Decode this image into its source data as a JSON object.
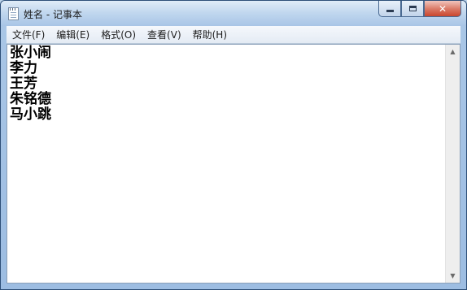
{
  "window": {
    "title": "姓名 - 记事本"
  },
  "menu": [
    {
      "label": "文件(F)"
    },
    {
      "label": "编辑(E)"
    },
    {
      "label": "格式(O)"
    },
    {
      "label": "查看(V)"
    },
    {
      "label": "帮助(H)"
    }
  ],
  "document": {
    "lines": [
      "张小闹",
      "李力",
      "王芳",
      "朱铭德",
      "马小跳"
    ]
  },
  "icons": {
    "app": "notepad-icon",
    "minimize": "minimize-icon",
    "maximize": "maximize-icon",
    "close": "close-icon",
    "scroll_up": "scroll-up-arrow-icon",
    "scroll_down": "scroll-down-arrow-icon"
  }
}
